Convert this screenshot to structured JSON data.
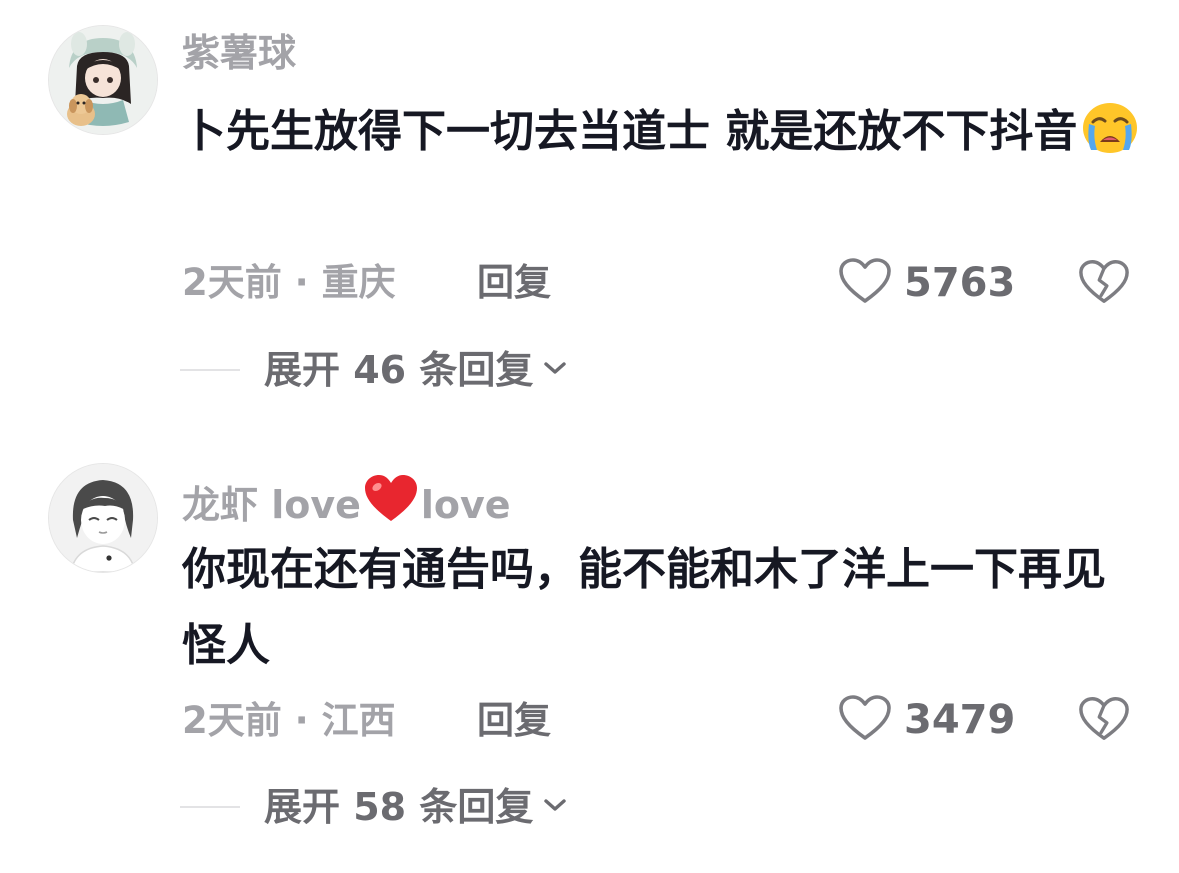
{
  "comments": [
    {
      "username": "紫薯球",
      "username_suffix": "",
      "text": "卜先生放得下一切去当道士 就是还放不下抖音",
      "emoji": "loudly-crying-face",
      "time_location": "2天前 · 重庆",
      "reply_label": "回复",
      "likes": "5763",
      "expand_label": "展开 46 条回复"
    },
    {
      "username": "龙虾 love",
      "username_suffix": "love",
      "username_emoji": "red-heart",
      "text": "你现在还有通告吗，能不能和木了洋上一下再见怪人",
      "time_location": "2天前 · 江西",
      "reply_label": "回复",
      "likes": "3479",
      "expand_label": "展开 58 条回复"
    }
  ],
  "colors": {
    "username": "#a3a3a8",
    "text": "#161823",
    "meta": "#a3a3a8",
    "action": "#6b6b70",
    "heart_emoji": "#e8262f",
    "crying_emoji": "#ffc629"
  },
  "icons": [
    "heart-outline-icon",
    "broken-heart-icon",
    "chevron-down-icon"
  ]
}
